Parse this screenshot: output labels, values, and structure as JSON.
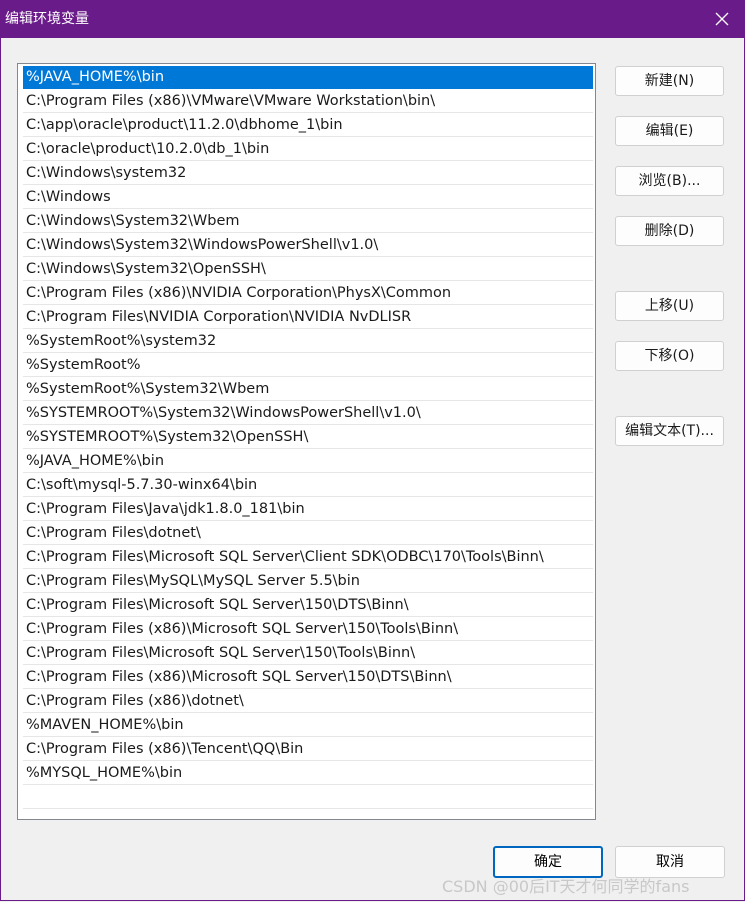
{
  "window": {
    "title": "编辑环境变量",
    "close_icon": "close-icon"
  },
  "paths": [
    "%JAVA_HOME%\\bin",
    "C:\\Program Files (x86)\\VMware\\VMware Workstation\\bin\\",
    "C:\\app\\oracle\\product\\11.2.0\\dbhome_1\\bin",
    "C:\\oracle\\product\\10.2.0\\db_1\\bin",
    "C:\\Windows\\system32",
    "C:\\Windows",
    "C:\\Windows\\System32\\Wbem",
    "C:\\Windows\\System32\\WindowsPowerShell\\v1.0\\",
    "C:\\Windows\\System32\\OpenSSH\\",
    "C:\\Program Files (x86)\\NVIDIA Corporation\\PhysX\\Common",
    "C:\\Program Files\\NVIDIA Corporation\\NVIDIA NvDLISR",
    "%SystemRoot%\\system32",
    "%SystemRoot%",
    "%SystemRoot%\\System32\\Wbem",
    "%SYSTEMROOT%\\System32\\WindowsPowerShell\\v1.0\\",
    "%SYSTEMROOT%\\System32\\OpenSSH\\",
    "%JAVA_HOME%\\bin",
    "C:\\soft\\mysql-5.7.30-winx64\\bin",
    "C:\\Program Files\\Java\\jdk1.8.0_181\\bin",
    "C:\\Program Files\\dotnet\\",
    "C:\\Program Files\\Microsoft SQL Server\\Client SDK\\ODBC\\170\\Tools\\Binn\\",
    "C:\\Program Files\\MySQL\\MySQL Server 5.5\\bin",
    "C:\\Program Files\\Microsoft SQL Server\\150\\DTS\\Binn\\",
    "C:\\Program Files (x86)\\Microsoft SQL Server\\150\\Tools\\Binn\\",
    "C:\\Program Files\\Microsoft SQL Server\\150\\Tools\\Binn\\",
    "C:\\Program Files (x86)\\Microsoft SQL Server\\150\\DTS\\Binn\\",
    "C:\\Program Files (x86)\\dotnet\\",
    "%MAVEN_HOME%\\bin",
    "C:\\Program Files (x86)\\Tencent\\QQ\\Bin",
    "%MYSQL_HOME%\\bin"
  ],
  "buttons": {
    "new": "新建(N)",
    "edit": "编辑(E)",
    "browse": "浏览(B)...",
    "delete": "删除(D)",
    "move_up": "上移(U)",
    "move_down": "下移(O)",
    "edit_text": "编辑文本(T)...",
    "ok": "确定",
    "cancel": "取消"
  },
  "watermark": "CSDN @00后IT天才何同学的fans",
  "colors": {
    "titlebar": "#6a1b8a",
    "selection": "#0078d7",
    "ok_border": "#0067c0"
  }
}
